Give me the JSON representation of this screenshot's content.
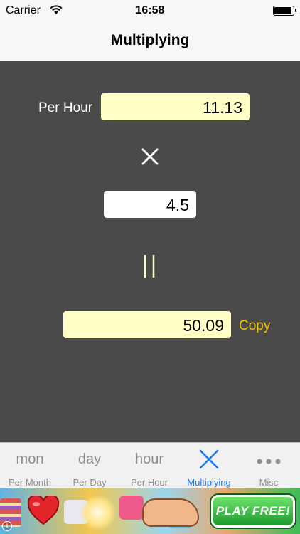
{
  "status_bar": {
    "carrier": "Carrier",
    "time": "16:58",
    "battery_level": 0.95
  },
  "nav": {
    "title": "Multiplying"
  },
  "calculator": {
    "rate_label": "Per Hour",
    "rate_value": "11.13",
    "multiply_symbol": "multiply-icon",
    "factor_value": "4.5",
    "equals_symbol": "equals-icon",
    "result_value": "50.09",
    "copy_label": "Copy"
  },
  "tabs": [
    {
      "glyph": "mon",
      "label": "Per Month",
      "active": false
    },
    {
      "glyph": "day",
      "label": "Per Day",
      "active": false
    },
    {
      "glyph": "hour",
      "label": "Per Hour",
      "active": false
    },
    {
      "icon": "multiply-icon",
      "label": "Multiplying",
      "active": true
    },
    {
      "icon": "more-dots-icon",
      "label": "Misc",
      "active": false
    }
  ],
  "ad": {
    "cta_label": "PLAY FREE!",
    "info_glyph": "i"
  },
  "colors": {
    "background": "#4a4a4a",
    "field_highlight": "#ffffc6",
    "copy_accent": "#f5c400",
    "tab_active": "#1a7af4",
    "tab_inactive": "#8e8e8e"
  }
}
